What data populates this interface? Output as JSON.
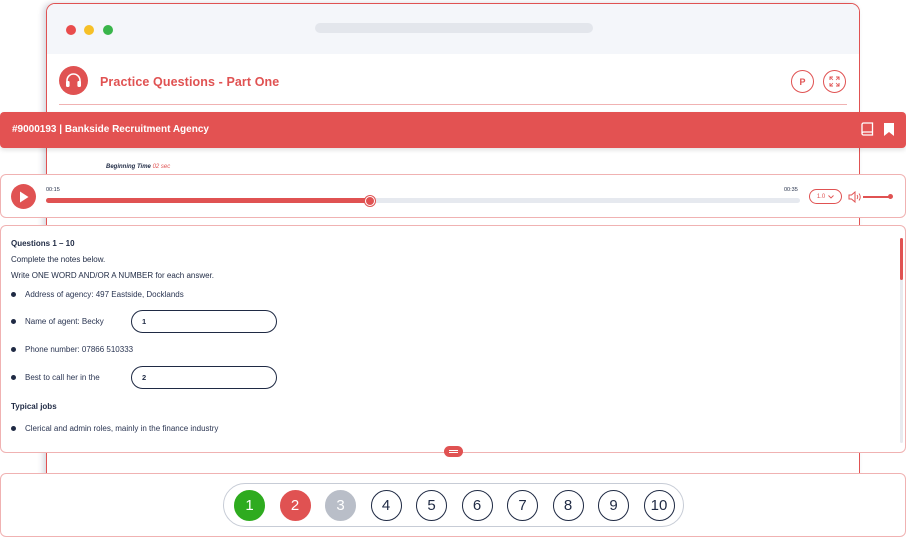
{
  "app": {
    "title": "Practice Questions - Part One",
    "p_button": "P"
  },
  "test": {
    "title": "#9000193 | Bankside Recruitment Agency"
  },
  "beginning": {
    "label": "Beginning Time",
    "value": "02 sec"
  },
  "audio": {
    "current_time": "00:15",
    "total_time": "00:35",
    "progress_fraction": 0.43,
    "speed": "1.0",
    "volume_fraction": 0.9
  },
  "questions": {
    "heading": "Questions 1 – 10",
    "instruction_1": "Complete the notes below.",
    "instruction_2": "Write ONE WORD AND/OR A NUMBER for each answer.",
    "items": [
      {
        "text": "Address of agency: 497 Eastside, Docklands"
      },
      {
        "text": "Name of agent: Becky",
        "blank": "1"
      },
      {
        "text": "Phone number: 07866 510333"
      },
      {
        "text": "Best to call her in the",
        "blank": "2"
      }
    ],
    "subheading": "Typical jobs",
    "sub_items": [
      {
        "text": "Clerical and admin roles, mainly in the finance industry"
      }
    ]
  },
  "navigation": {
    "numbers": [
      {
        "label": "1",
        "state": "answered"
      },
      {
        "label": "2",
        "state": "current"
      },
      {
        "label": "3",
        "state": "visited"
      },
      {
        "label": "4",
        "state": "default"
      },
      {
        "label": "5",
        "state": "default"
      },
      {
        "label": "6",
        "state": "default"
      },
      {
        "label": "7",
        "state": "default"
      },
      {
        "label": "8",
        "state": "default"
      },
      {
        "label": "9",
        "state": "default"
      },
      {
        "label": "10",
        "state": "default"
      }
    ]
  },
  "colors": {
    "accent": "#e05252",
    "answered": "#2eab1f",
    "visited": "#b9bec8",
    "text": "#1f2a44"
  },
  "icons": [
    "headphones-icon",
    "fullscreen-icon",
    "book-icon",
    "bookmark-icon",
    "play-icon",
    "chevron-down-icon",
    "volume-icon",
    "drag-handle-icon"
  ]
}
